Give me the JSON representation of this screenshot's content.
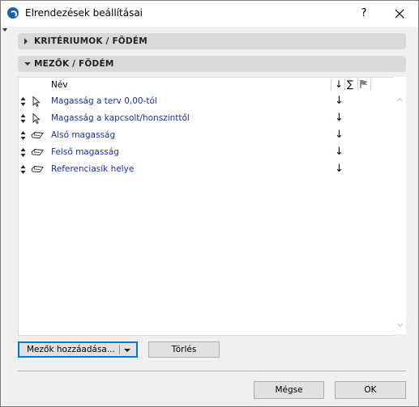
{
  "window": {
    "title": "Elrendezések beállításai",
    "help_glyph": "?",
    "icons": {
      "app": "archicad-logo-icon",
      "help": "help-icon",
      "close": "close-icon",
      "pin": "pin-icon"
    }
  },
  "sections": [
    {
      "label": "KRITÉRIUMOK /  FÖDÉM",
      "expanded": false
    },
    {
      "label": "MEZŐK /  FÖDÉM",
      "expanded": true
    }
  ],
  "fields_table": {
    "header": {
      "name": "Név",
      "sort_glyph": "↓",
      "sum_glyph": "∑",
      "flag_icon": "flag-icon"
    },
    "rows": [
      {
        "label": "Magasság a terv 0,00-tól",
        "icon": "cursor-arrow-icon",
        "sort": "↓"
      },
      {
        "label": "Magasság a kapcsolt/honszinttől",
        "icon": "cursor-arrow-icon",
        "sort": "↓"
      },
      {
        "label": "Alsó magasság",
        "icon": "slab-tag-icon",
        "sort": "↓"
      },
      {
        "label": "Felső magasság",
        "icon": "slab-tag-icon",
        "sort": "↓"
      },
      {
        "label": "Referenciasík helye",
        "icon": "slab-tag-icon",
        "sort": "↓"
      }
    ]
  },
  "buttons": {
    "add_fields": "Mezők hozzáadása...",
    "delete": "Törlés",
    "cancel": "Mégse",
    "ok": "OK"
  },
  "colors": {
    "accent": "#0078d7",
    "field_text": "#1c2fa8",
    "section_bg": "#d9d9d9",
    "dialog_bg": "#f0f0f0"
  }
}
